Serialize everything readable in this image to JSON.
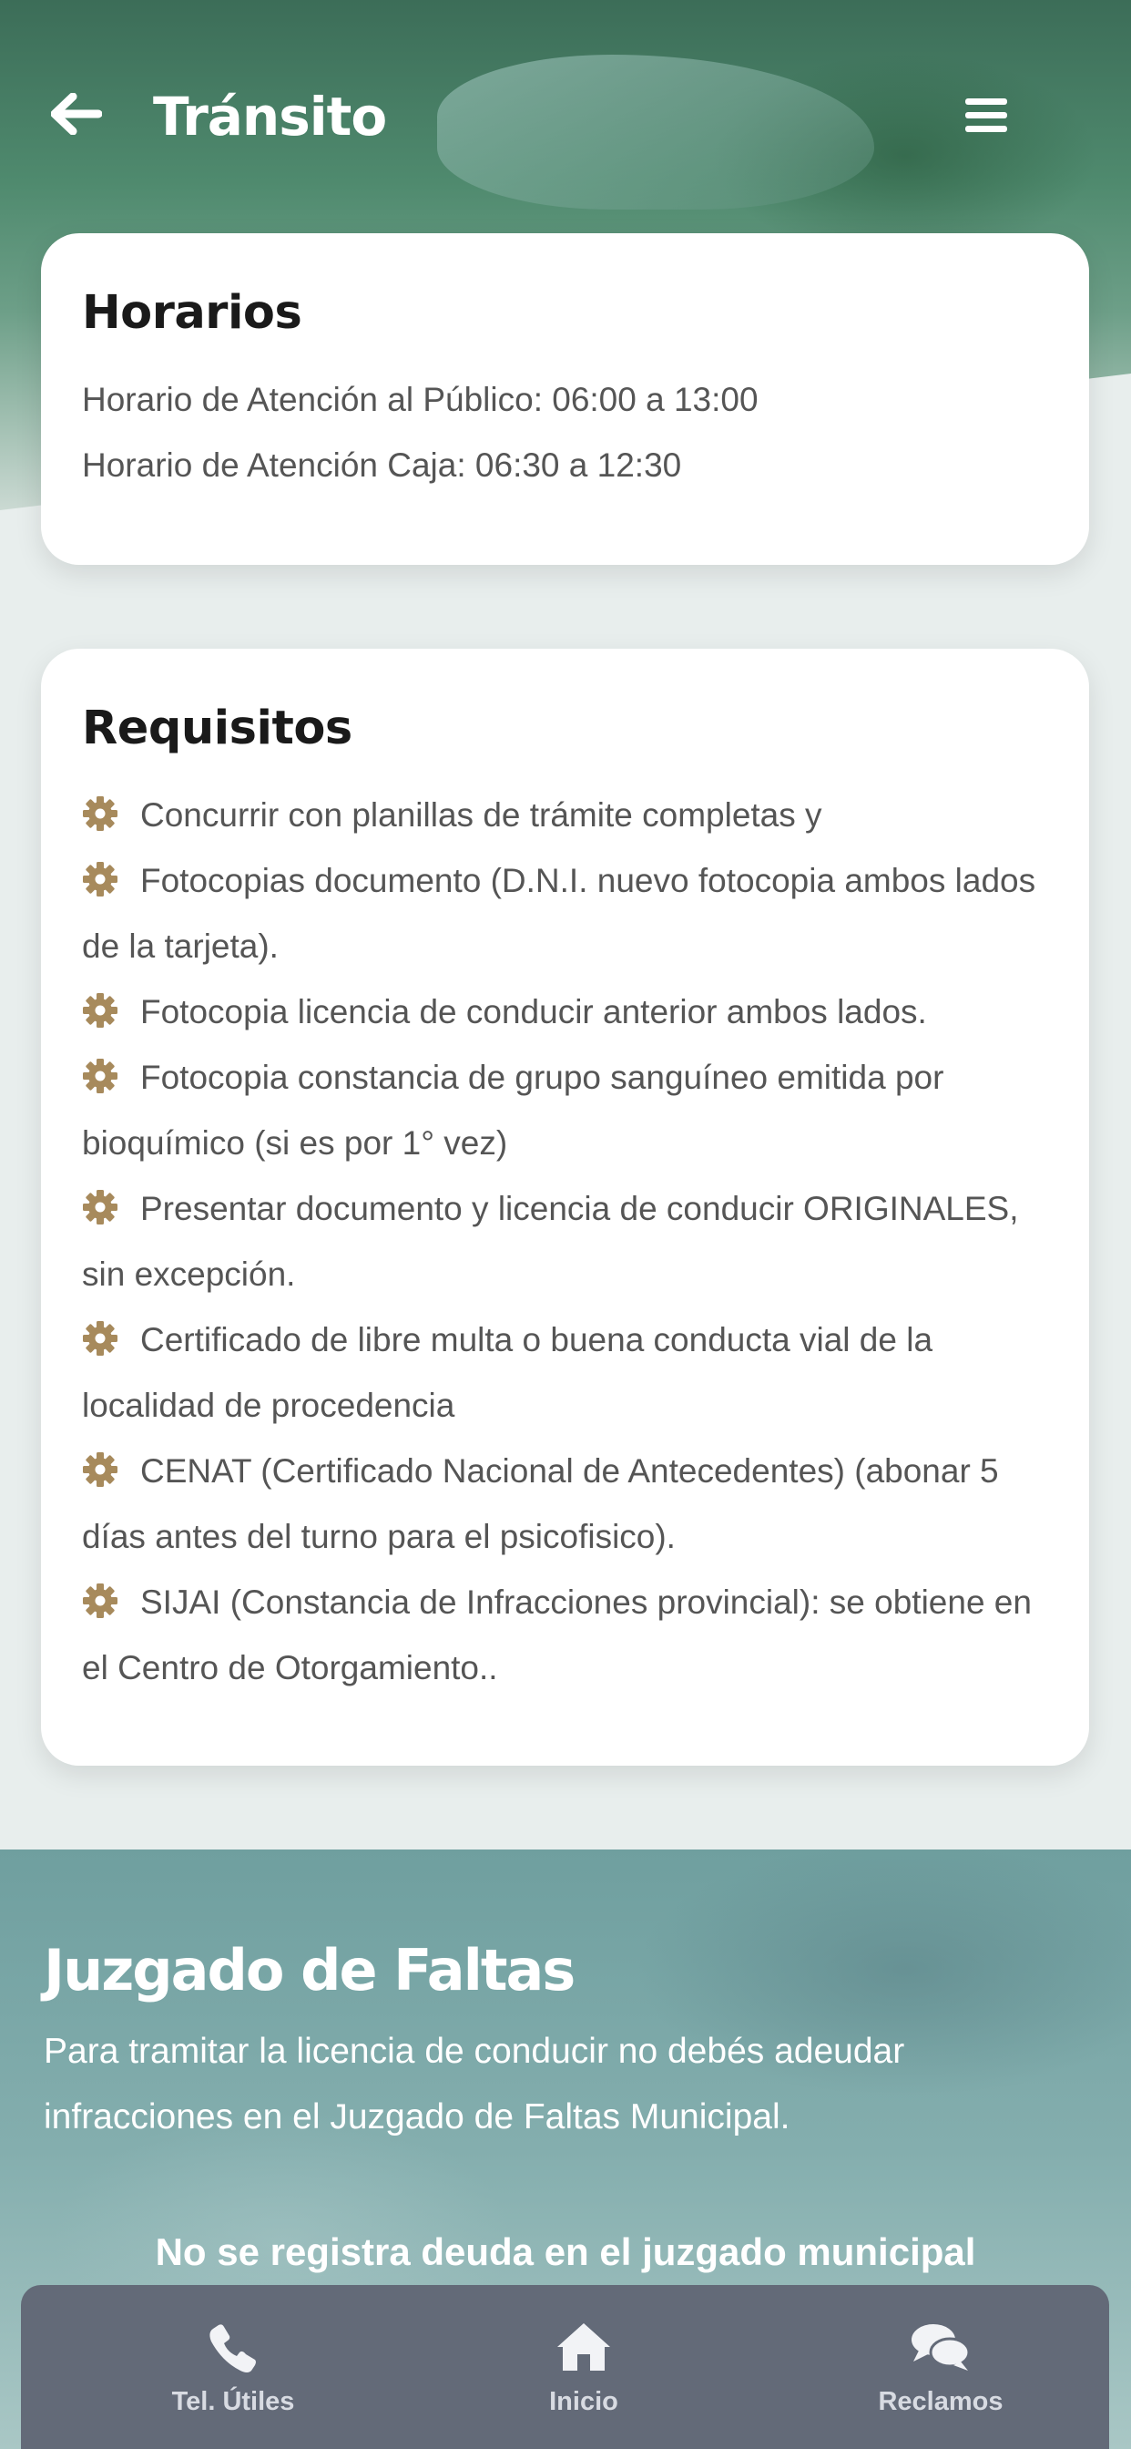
{
  "header": {
    "title": "Tránsito",
    "back_icon": "arrow-left-icon",
    "menu_icon": "hamburger-menu-icon"
  },
  "horarios": {
    "title": "Horarios",
    "lines": [
      "Horario de Atención al Público: 06:00 a 13:00",
      "Horario de Atención Caja: 06:30 a 12:30"
    ]
  },
  "requisitos": {
    "title": "Requisitos",
    "icon": "gear-icon",
    "icon_color": "#a78a5c",
    "items": [
      "Concurrir con planillas de trámite completas y",
      "Fotocopias documento (D.N.I. nuevo fotocopia ambos lados de la tarjeta).",
      "Fotocopia licencia de conducir anterior ambos lados.",
      "Fotocopia constancia de grupo sanguíneo emitida por bioquímico (si es por 1° vez)",
      "Presentar documento y licencia de conducir ORIGINALES, sin excepción.",
      "Certificado de libre multa o buena conducta vial de la localidad de procedencia",
      "CENAT (Certificado Nacional de Antecedentes) (abonar 5 días antes del turno para el psicofisico).",
      "SIJAI (Constancia de Infracciones provincial): se obtiene en el Centro de Otorgamiento.."
    ]
  },
  "juzgado": {
    "title": "Juzgado de Faltas",
    "description": "Para tramitar la licencia de conducir no debés adeudar infracciones en el Juzgado de Faltas Municipal.",
    "status": "No se registra deuda en el juzgado municipal"
  },
  "bottom_nav": {
    "items": [
      {
        "label": "Tel. Útiles",
        "icon": "phone-icon"
      },
      {
        "label": "Inicio",
        "icon": "home-icon"
      },
      {
        "label": "Reclamos",
        "icon": "chat-bubbles-icon"
      }
    ]
  }
}
